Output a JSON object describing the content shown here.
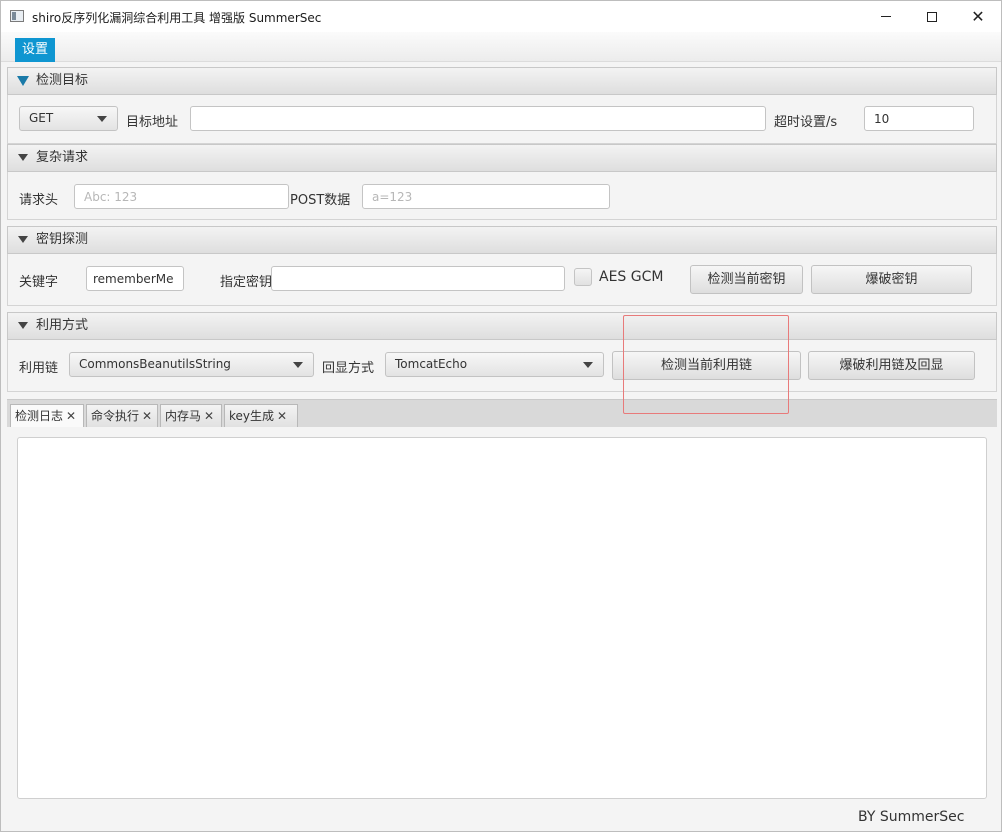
{
  "window": {
    "title": "shiro反序列化漏洞综合利用工具 增强版 SummerSec"
  },
  "menu": {
    "settings": "设置"
  },
  "target_section": {
    "title": "检测目标",
    "method": "GET",
    "url_label": "目标地址",
    "url_value": "",
    "timeout_label": "超时设置/s",
    "timeout_value": "10"
  },
  "complex_request": {
    "title": "复杂请求",
    "headers_label": "请求头",
    "headers_placeholder": "Abc: 123",
    "post_label": "POST数据",
    "post_placeholder": "a=123"
  },
  "key_detect": {
    "title": "密钥探测",
    "keyword_label": "关键字",
    "keyword_value": "rememberMe",
    "key_label": "指定密钥",
    "key_value": "",
    "aes_gcm_label": "AES GCM",
    "aes_gcm_checked": false,
    "detect_key_button": "检测当前密钥",
    "brute_key_button": "爆破密钥"
  },
  "exploit": {
    "title": "利用方式",
    "chain_label": "利用链",
    "chain_value": "CommonsBeanutilsString",
    "echo_label": "回显方式",
    "echo_value": "TomcatEcho",
    "detect_chain_button": "检测当前利用链",
    "brute_chain_button": "爆破利用链及回显"
  },
  "tabs": [
    {
      "label": "检测日志",
      "active": true
    },
    {
      "label": "命令执行",
      "active": false
    },
    {
      "label": "内存马",
      "active": false
    },
    {
      "label": "key生成",
      "active": false
    }
  ],
  "footer": {
    "credit": "BY   SummerSec"
  },
  "colors": {
    "menu_accent": "#0f96d1",
    "annotation": "#e87a7a"
  }
}
